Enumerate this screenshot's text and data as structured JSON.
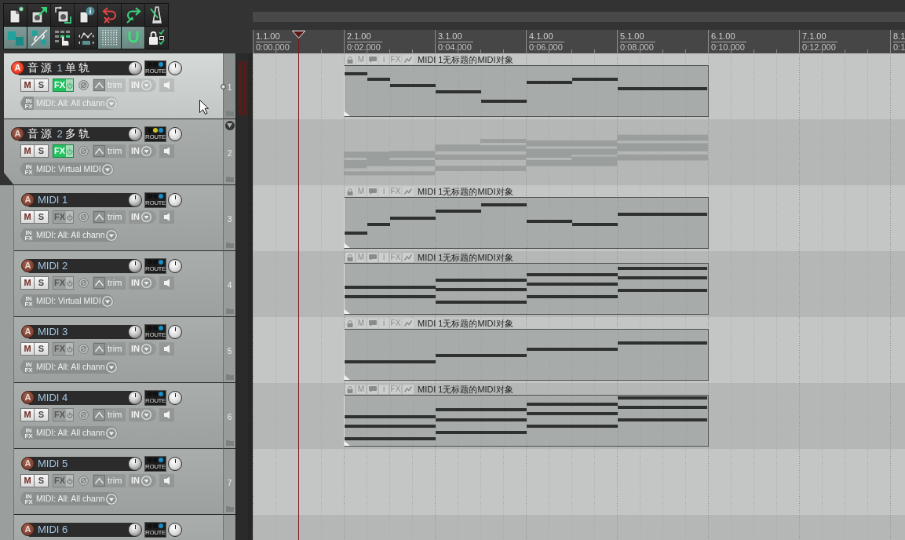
{
  "toolbar": [
    [
      {
        "kind": "new_project",
        "on": false
      },
      {
        "kind": "open_project",
        "on": false
      },
      {
        "kind": "save_project",
        "on": false
      },
      {
        "kind": "project_info",
        "on": false
      },
      {
        "kind": "undo",
        "on": false
      },
      {
        "kind": "redo",
        "on": false
      },
      {
        "kind": "metronome",
        "on": false
      }
    ],
    [
      {
        "kind": "snap",
        "on": true
      },
      {
        "kind": "ripple",
        "on": true
      },
      {
        "kind": "grouping",
        "on": false
      },
      {
        "kind": "envelope_points",
        "on": false
      },
      {
        "kind": "grid",
        "on": true
      },
      {
        "kind": "loop",
        "on": true
      },
      {
        "kind": "lock",
        "on": false
      }
    ]
  ],
  "ruler": [
    {
      "bar": "1.1.00",
      "time": "0:00.000"
    },
    {
      "bar": "2.1.00",
      "time": "0:02.000"
    },
    {
      "bar": "3.1.00",
      "time": "0:04.000"
    },
    {
      "bar": "4.1.00",
      "time": "0:06.000"
    },
    {
      "bar": "5.1.00",
      "time": "0:08.000"
    },
    {
      "bar": "6.1.00",
      "time": "0:10.000"
    },
    {
      "bar": "7.1.00",
      "time": "0:12.000"
    },
    {
      "bar": "8.1",
      "time": "0:1"
    }
  ],
  "tracks": [
    {
      "arm_label": "A",
      "armed": true,
      "selected": true,
      "name": "音源 1 单轨",
      "route_label": "ROUTE",
      "route_dots": [
        {
          "color": "#111111"
        },
        {
          "color": "#111111"
        },
        {
          "color": "#1b8ec4"
        }
      ],
      "mute_label": "M",
      "solo_label": "S",
      "fx_label": "FX",
      "fx_enabled": true,
      "envelope_label": "trim",
      "input_label": "IN",
      "input_fx": [
        "IN",
        "FX"
      ],
      "midi_input": "MIDI: All: All chann",
      "number": "1",
      "midi_item": {
        "mute_label": "M",
        "info_label": "i",
        "fx_label": "FX",
        "title": "MIDI 1无标题的MIDI对象"
      }
    },
    {
      "arm_label": "A",
      "armed": false,
      "selected": false,
      "name": "音源 2 多轨",
      "route_label": "ROUTE",
      "route_dots": [
        {
          "color": "#111111"
        },
        {
          "color": "#c9c21e"
        },
        {
          "color": "#1b8ec4"
        }
      ],
      "mute_label": "M",
      "solo_label": "S",
      "fx_label": "FX",
      "fx_enabled": true,
      "envelope_label": "trim",
      "input_label": "IN",
      "input_fx": [
        "IN",
        "FX"
      ],
      "midi_input": "MIDI: Virtual MIDI",
      "number": "2",
      "expanded": true,
      "children": [
        {
          "arm_label": "A",
          "armed": false,
          "selected": false,
          "name": "MIDI 1",
          "route_label": "ROUTE",
          "route_dots": [
            {
              "color": "#111111"
            },
            {
              "color": "#111111"
            },
            {
              "color": "#1b8ec4"
            }
          ],
          "mute_label": "M",
          "solo_label": "S",
          "fx_label": "FX",
          "fx_enabled": false,
          "envelope_label": "trim",
          "input_label": "IN",
          "input_fx": [
            "IN",
            "FX"
          ],
          "midi_input": "MIDI: All: All chann",
          "number": "3",
          "midi_item": {
            "mute_label": "M",
            "info_label": "i",
            "fx_label": "FX",
            "title": "MIDI 1无标题的MIDI对象"
          }
        },
        {
          "arm_label": "A",
          "armed": false,
          "selected": false,
          "name": "MIDI 2",
          "route_label": "ROUTE",
          "route_dots": [
            {
              "color": "#111111"
            },
            {
              "color": "#111111"
            },
            {
              "color": "#1b8ec4"
            }
          ],
          "mute_label": "M",
          "solo_label": "S",
          "fx_label": "FX",
          "fx_enabled": false,
          "envelope_label": "trim",
          "input_label": "IN",
          "input_fx": [
            "IN",
            "FX"
          ],
          "midi_input": "MIDI: Virtual MIDI",
          "number": "4",
          "midi_item": {
            "mute_label": "M",
            "info_label": "i",
            "fx_label": "FX",
            "title": "MIDI 1无标题的MIDI对象"
          }
        },
        {
          "arm_label": "A",
          "armed": false,
          "selected": false,
          "name": "MIDI 3",
          "route_label": "ROUTE",
          "route_dots": [
            {
              "color": "#111111"
            },
            {
              "color": "#111111"
            },
            {
              "color": "#1b8ec4"
            }
          ],
          "mute_label": "M",
          "solo_label": "S",
          "fx_label": "FX",
          "fx_enabled": false,
          "envelope_label": "trim",
          "input_label": "IN",
          "input_fx": [
            "IN",
            "FX"
          ],
          "midi_input": "MIDI: All: All chann",
          "number": "5",
          "midi_item": {
            "mute_label": "M",
            "info_label": "i",
            "fx_label": "FX",
            "title": "MIDI 1无标题的MIDI对象"
          }
        },
        {
          "arm_label": "A",
          "armed": false,
          "selected": false,
          "name": "MIDI 4",
          "route_label": "ROUTE",
          "route_dots": [
            {
              "color": "#111111"
            },
            {
              "color": "#111111"
            },
            {
              "color": "#1b8ec4"
            }
          ],
          "mute_label": "M",
          "solo_label": "S",
          "fx_label": "FX",
          "fx_enabled": false,
          "envelope_label": "trim",
          "input_label": "IN",
          "input_fx": [
            "IN",
            "FX"
          ],
          "midi_input": "MIDI: All: All chann",
          "number": "6",
          "midi_item": {
            "mute_label": "M",
            "info_label": "i",
            "fx_label": "FX",
            "title": "MIDI 1无标题的MIDI对象"
          }
        },
        {
          "arm_label": "A",
          "armed": false,
          "selected": false,
          "name": "MIDI 5",
          "route_label": "ROUTE",
          "route_dots": [
            {
              "color": "#111111"
            },
            {
              "color": "#111111"
            },
            {
              "color": "#1b8ec4"
            }
          ],
          "mute_label": "M",
          "solo_label": "S",
          "fx_label": "FX",
          "fx_enabled": false,
          "envelope_label": "trim",
          "input_label": "IN",
          "input_fx": [
            "IN",
            "FX"
          ],
          "midi_input": "MIDI: All: All chann",
          "number": "7"
        },
        {
          "arm_label": "A",
          "armed": false,
          "selected": false,
          "name": "MIDI 6",
          "route_label": "ROUTE",
          "route_dots": [
            {
              "color": "#111111"
            },
            {
              "color": "#111111"
            },
            {
              "color": "#1b8ec4"
            }
          ]
        }
      ]
    }
  ]
}
